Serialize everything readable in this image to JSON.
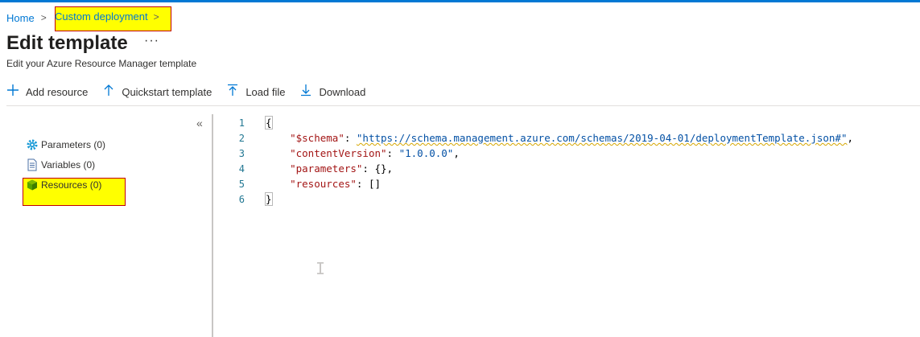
{
  "breadcrumb": {
    "home": "Home",
    "current": "Custom deployment"
  },
  "page": {
    "title": "Edit template",
    "more": "···",
    "subtitle": "Edit your Azure Resource Manager template"
  },
  "toolbar": {
    "add_resource": "Add resource",
    "quickstart_template": "Quickstart template",
    "load_file": "Load file",
    "download": "Download"
  },
  "outline": {
    "collapse": "«",
    "parameters": "Parameters (0)",
    "variables": "Variables (0)",
    "resources": "Resources (0)"
  },
  "editor": {
    "line_numbers": [
      "1",
      "2",
      "3",
      "4",
      "5",
      "6"
    ],
    "lines": {
      "l1": "{",
      "schema_key": "\"$schema\"",
      "schema_val": "\"https://schema.management.azure.com/schemas/2019-04-01/deploymentTemplate.json#\"",
      "cv_key": "\"contentVersion\"",
      "cv_val": "\"1.0.0.0\"",
      "params_key": "\"parameters\"",
      "params_val": "{}",
      "res_key": "\"resources\"",
      "res_val": "[]",
      "l6": "}"
    }
  },
  "colors": {
    "accent": "#0078d4",
    "highlight": "#ffff00",
    "highlight_border": "#c00000"
  }
}
